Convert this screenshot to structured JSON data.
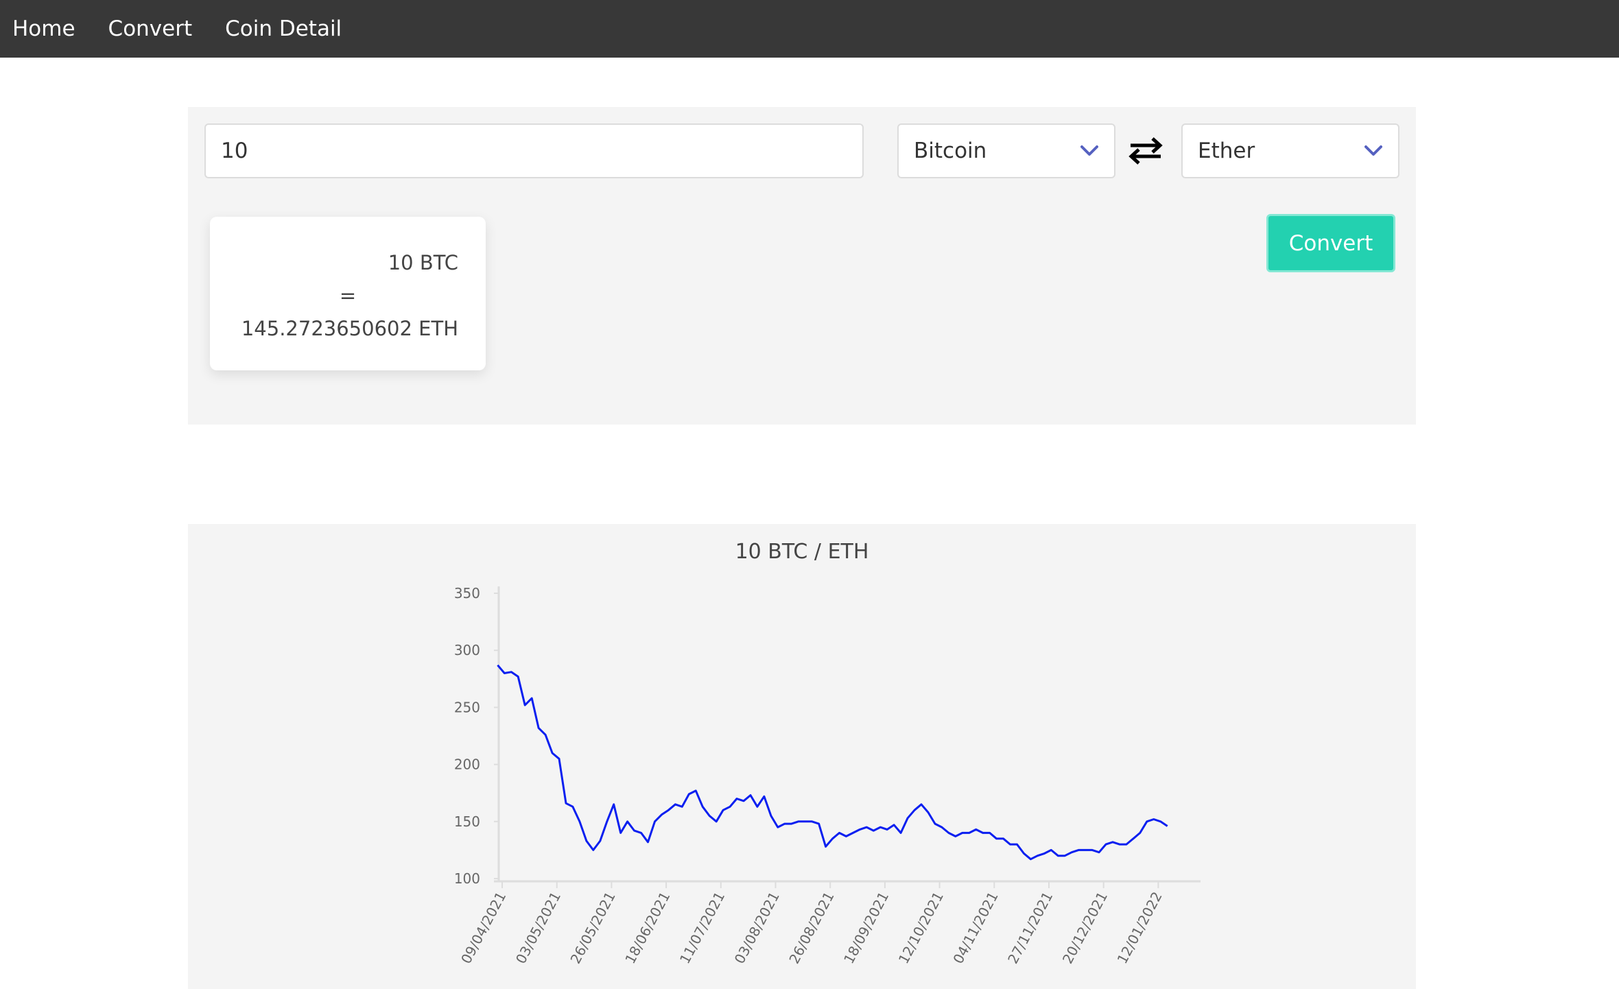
{
  "nav": {
    "items": [
      "Home",
      "Convert",
      "Coin Detail"
    ]
  },
  "converter": {
    "amount": "10",
    "from_currency": "Bitcoin",
    "to_currency": "Ether",
    "convert_label": "Convert",
    "result": {
      "amount_line": "10 BTC",
      "equals": "=",
      "result_line": "145.2723650602 ETH"
    }
  },
  "colors": {
    "navbar": "#383838",
    "accent": "#23d1b0",
    "chevron": "#5561c0",
    "line": "#0a1ff0",
    "panel": "#f4f4f4"
  },
  "icons": [
    "chevron-down-icon",
    "swap-arrows-icon"
  ],
  "chart_data": {
    "type": "line",
    "title": "10 BTC / ETH",
    "xlabel": "",
    "ylabel": "",
    "ylim": [
      100,
      350
    ],
    "yticks": [
      100,
      150,
      200,
      250,
      300,
      350
    ],
    "xticks": [
      "09/04/2021",
      "03/05/2021",
      "26/05/2021",
      "18/06/2021",
      "11/07/2021",
      "03/08/2021",
      "26/08/2021",
      "18/09/2021",
      "12/10/2021",
      "04/11/2021",
      "27/11/2021",
      "20/12/2021",
      "12/01/2022"
    ],
    "grid": false,
    "legend": "none",
    "series": [
      {
        "x": [
          "07/04/2021",
          "10/04/2021",
          "13/04/2021",
          "16/04/2021",
          "19/04/2021",
          "22/04/2021",
          "25/04/2021",
          "28/04/2021",
          "01/05/2021",
          "04/05/2021",
          "07/05/2021",
          "10/05/2021",
          "13/05/2021",
          "16/05/2021",
          "19/05/2021",
          "22/05/2021",
          "25/05/2021",
          "28/05/2021",
          "31/05/2021",
          "03/06/2021",
          "06/06/2021",
          "09/06/2021",
          "12/06/2021",
          "15/06/2021",
          "18/06/2021",
          "21/06/2021",
          "24/06/2021",
          "27/06/2021",
          "30/06/2021",
          "03/07/2021",
          "06/07/2021",
          "09/07/2021",
          "12/07/2021",
          "15/07/2021",
          "18/07/2021",
          "21/07/2021",
          "24/07/2021",
          "27/07/2021",
          "30/07/2021",
          "02/08/2021",
          "05/08/2021",
          "08/08/2021",
          "11/08/2021",
          "14/08/2021",
          "17/08/2021",
          "20/08/2021",
          "23/08/2021",
          "26/08/2021",
          "29/08/2021",
          "01/09/2021",
          "04/09/2021",
          "07/09/2021",
          "10/09/2021",
          "13/09/2021",
          "16/09/2021",
          "19/09/2021",
          "22/09/2021",
          "25/09/2021",
          "28/09/2021",
          "01/10/2021",
          "04/10/2021",
          "07/10/2021",
          "10/10/2021",
          "13/10/2021",
          "16/10/2021",
          "19/10/2021",
          "22/10/2021",
          "25/10/2021",
          "28/10/2021",
          "31/10/2021",
          "03/11/2021",
          "06/11/2021",
          "09/11/2021",
          "12/11/2021",
          "15/11/2021",
          "18/11/2021",
          "21/11/2021",
          "24/11/2021",
          "27/11/2021",
          "30/11/2021",
          "03/12/2021",
          "06/12/2021",
          "09/12/2021",
          "12/12/2021",
          "15/12/2021",
          "18/12/2021",
          "21/12/2021",
          "24/12/2021",
          "27/12/2021",
          "30/12/2021",
          "02/01/2022",
          "05/01/2022",
          "08/01/2022",
          "11/01/2022",
          "14/01/2022",
          "17/01/2022",
          "20/01/2022",
          "23/01/2022",
          "26/01/2022"
        ],
        "values": [
          287,
          280,
          281,
          277,
          252,
          258,
          232,
          226,
          210,
          205,
          166,
          163,
          150,
          133,
          125,
          133,
          150,
          165,
          140,
          150,
          142,
          140,
          132,
          150,
          156,
          160,
          165,
          163,
          174,
          177,
          163,
          155,
          150,
          160,
          163,
          170,
          168,
          173,
          163,
          172,
          155,
          145,
          148,
          148,
          150,
          150,
          150,
          148,
          128,
          135,
          140,
          137,
          140,
          143,
          145,
          142,
          145,
          143,
          147,
          140,
          153,
          160,
          165,
          158,
          148,
          145,
          140,
          137,
          140,
          140,
          143,
          140,
          140,
          135,
          135,
          130,
          130,
          122,
          117,
          120,
          122,
          125,
          120,
          120,
          123,
          125,
          125,
          125,
          123,
          130,
          132,
          130,
          130,
          135,
          140,
          150,
          152,
          150,
          146
        ]
      }
    ]
  }
}
